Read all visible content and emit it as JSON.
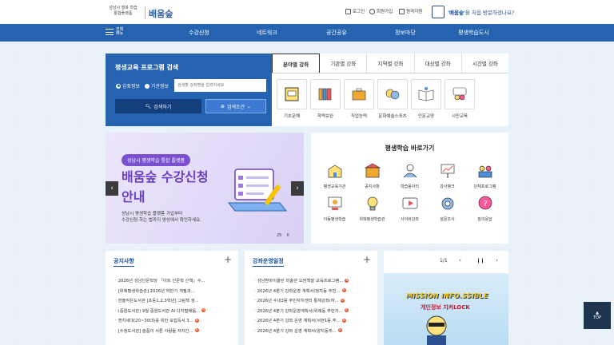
{
  "header": {
    "logo_sub1": "성남시 행복 학습",
    "logo_sub2": "통합플랫폼",
    "logo_main": "배움숲",
    "utils": [
      "로그인",
      "회원가입",
      "원격지원"
    ],
    "visit_prefix": "'배움숲'",
    "visit_suffix": "을 처음 방문하셨나요?"
  },
  "nav": {
    "all_label": "전체메뉴",
    "items": [
      "수강신청",
      "네트워크",
      "공간공유",
      "정보마당",
      "평생학습도시"
    ]
  },
  "search": {
    "title": "평생교육 프로그램 검색",
    "radio1": "강좌정보",
    "radio2": "기관정보",
    "placeholder": "검색할 강좌명을 입력하세요",
    "search_button": "검색하기",
    "filter_button": "검색조건"
  },
  "tabs": {
    "items": [
      "분야별 강좌",
      "기관별 강좌",
      "지역별 강좌",
      "대상별 강좌",
      "시간별 강좌"
    ],
    "categories": [
      "기초문해",
      "학력보완",
      "직업능력",
      "문화예술스포츠",
      "인문교양",
      "시민교육"
    ]
  },
  "banner": {
    "pill": "성남시 평생학습 통합 플랫폼",
    "title1": "배움숲 수강신청",
    "title2": "안내",
    "desc1": "성남시 평생학습 플랫폼 가입부터",
    "desc2": "수강신청 하는 법까지 영상에서 확인하세요.",
    "page_current": "25",
    "page_icon": "II"
  },
  "quick": {
    "title": "평생학습 바로가기",
    "items": [
      "평생교육기관",
      "공지사항",
      "학습동아리",
      "강사뱅크",
      "단체프로그램",
      "아동평생학습",
      "위례평생학습관",
      "사이버강좌",
      "설문조사",
      "질의응답"
    ]
  },
  "notice": {
    "title": "공지사항",
    "items": [
      "2026년 성남인문학당 「이트 인문학 산책」수...",
      "[위례평생학습관] 2026년 하반기 개필과...",
      "한솔작은도서관 [초등1,2,3학년] 그림책 생...",
      "(중원도서관) 9월 중원도서관 AI 디지털배움...",
      "찐지세대(20~30대)를 위한 모집독서 3...",
      "[수정도서관] 슬픔이 서툰 사람들 저자간..."
    ]
  },
  "schedule": {
    "title": "강좌운영일정",
    "items": [
      "성남환바이올린 미술관 오담책발 교육프로그램...",
      "2026년 4분기 강좌운영 계획서(정자동 주민...",
      "2026년 수내3동 주민자치센터 통체강좌(하...",
      "2026년 4분기 강좌운영계획서(위례동 주민자...",
      "2026년 4분기 강좌 운영 계획서(서현1동 주...",
      "2026년 4분기 강좌 운영 계획서(양지동주..."
    ]
  },
  "promo": {
    "counter": "1/1",
    "title": "MISSION INFO.SSIBLE",
    "subtitle": "개인정보 지켜LOCK"
  },
  "top_button": "TOP"
}
